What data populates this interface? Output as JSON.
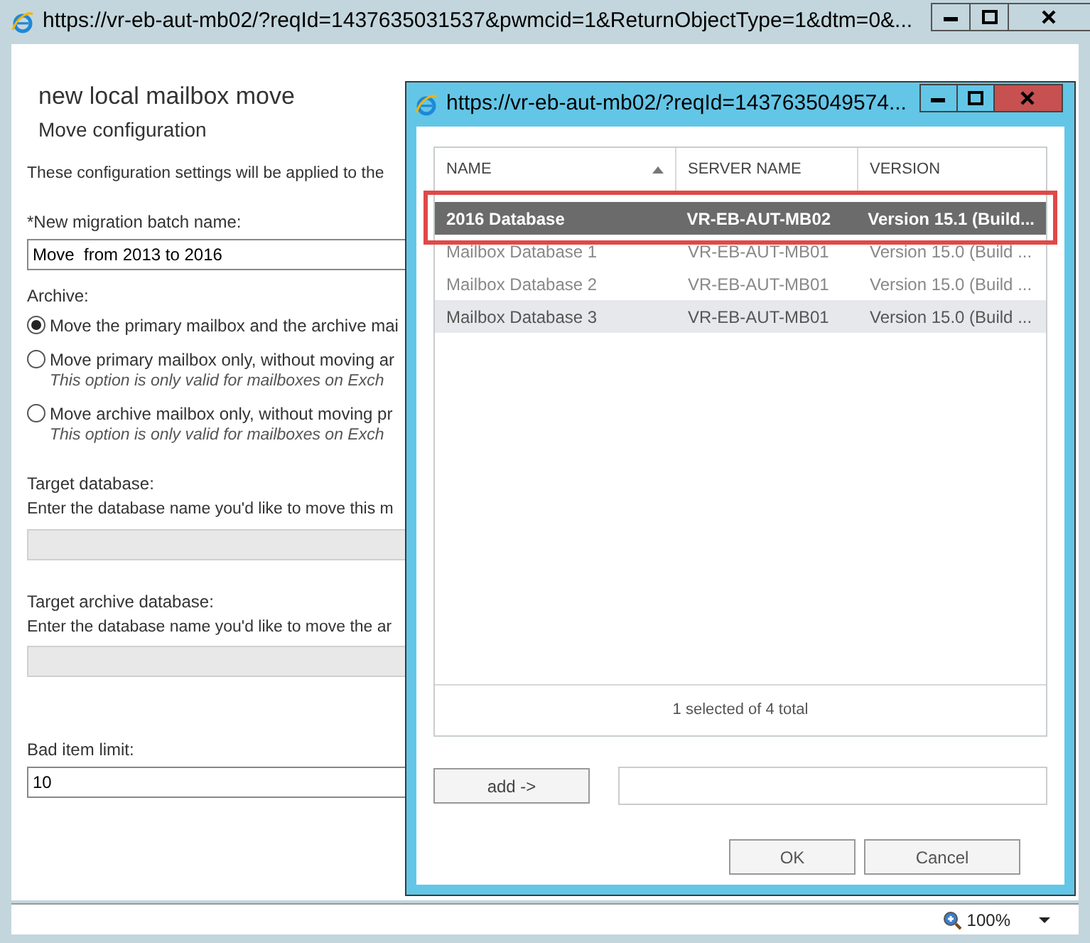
{
  "window": {
    "title": "https://vr-eb-aut-mb02/?reqId=1437635031537&pwmcid=1&ReturnObjectType=1&dtm=0&..."
  },
  "form": {
    "heading": "new local mailbox move",
    "subheading": "Move configuration",
    "intro": "These configuration settings will be applied to the",
    "batch_name": {
      "label": "*New migration batch name:",
      "value": "Move  from 2013 to 2016"
    },
    "archive": {
      "label": "Archive:",
      "options": [
        {
          "label": "Move the primary mailbox and the archive mai",
          "selected": true
        },
        {
          "label": "Move primary mailbox only, without moving ar",
          "note": "This option is only valid for mailboxes on Exch",
          "selected": false
        },
        {
          "label": "Move archive mailbox only, without moving pr",
          "note": "This option is only valid for mailboxes on Exch",
          "selected": false
        }
      ]
    },
    "target_database": {
      "label": "Target database:",
      "hint": "Enter the database name you'd like to move this m",
      "disabled": true
    },
    "target_archive_database": {
      "label": "Target archive database:",
      "hint": "Enter the database name you'd like to move the ar",
      "disabled": true
    },
    "bad_item_limit": {
      "label": "Bad item limit:",
      "value": "10",
      "disabled": false
    }
  },
  "dialog": {
    "title": "https://vr-eb-aut-mb02/?reqId=1437635049574...",
    "table": {
      "columns": [
        {
          "label": "NAME",
          "sorted": true
        },
        {
          "label": "SERVER NAME",
          "sorted": false
        },
        {
          "label": "VERSION",
          "sorted": false
        }
      ],
      "rows": [
        {
          "cells": [
            "2016 Database",
            "VR-EB-AUT-MB02",
            "Version 15.1 (Build..."
          ],
          "selected": true,
          "hovered": false,
          "highlighted": true
        },
        {
          "cells": [
            "Mailbox Database 1",
            "VR-EB-AUT-MB01",
            "Version 15.0 (Build ..."
          ],
          "selected": false,
          "hovered": false,
          "highlighted": false
        },
        {
          "cells": [
            "Mailbox Database 2",
            "VR-EB-AUT-MB01",
            "Version 15.0 (Build ..."
          ],
          "selected": false,
          "hovered": false,
          "highlighted": false
        },
        {
          "cells": [
            "Mailbox Database 3",
            "VR-EB-AUT-MB01",
            "Version 15.0 (Build ..."
          ],
          "selected": false,
          "hovered": true,
          "highlighted": false
        }
      ]
    },
    "footer": "1 selected of 4 total",
    "add_button": "add ->",
    "ok_button": "OK",
    "cancel_button": "Cancel"
  },
  "status_bar": {
    "zoom": "100%"
  }
}
